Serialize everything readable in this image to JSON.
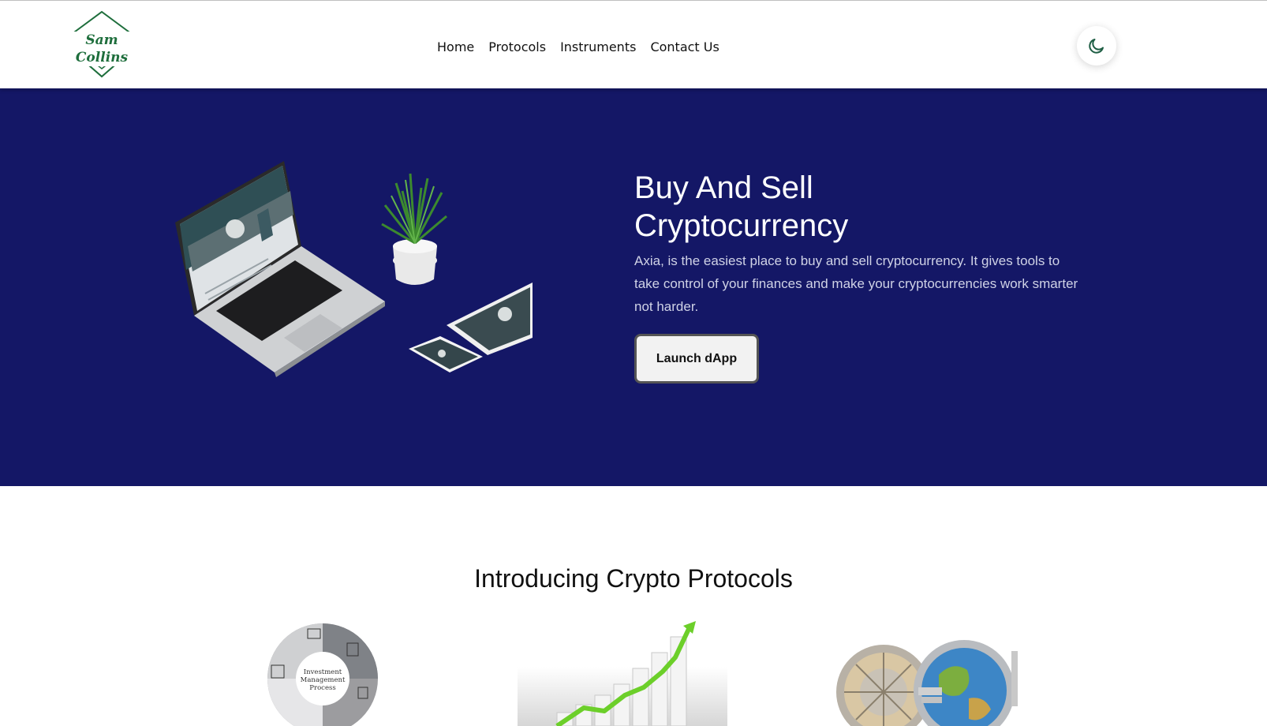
{
  "header": {
    "logo_text": "Sam Collins",
    "nav": [
      "Home",
      "Protocols",
      "Instruments",
      "Contact Us"
    ],
    "theme_icon": "moon-icon"
  },
  "hero": {
    "title_line1": "Buy And Sell",
    "title_line2": "Cryptocurrency",
    "description": "Axia, is the easiest place to buy and sell cryptocurrency. It gives tools to take control of your finances and make your cryptocurrencies work smarter not harder.",
    "button_label": "Launch dApp",
    "background": "#141766"
  },
  "protocols": {
    "title": "Introducing Crypto Protocols",
    "card1": {
      "center_line1": "Investment",
      "center_line2": "Management",
      "center_line3": "Process"
    }
  },
  "colors": {
    "brand_green": "#1e6e3c",
    "hero_bg": "#141766",
    "chart_arrow": "#6ccf2a"
  }
}
